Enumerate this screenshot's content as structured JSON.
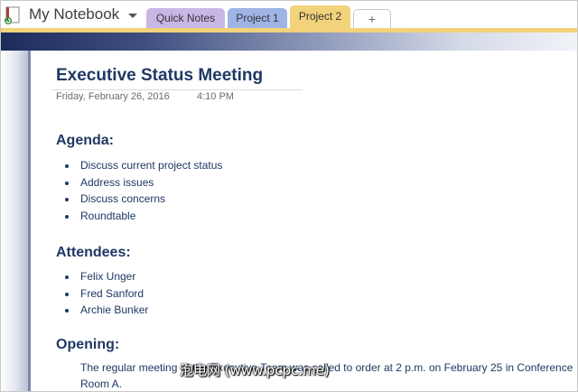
{
  "notebook": {
    "title": "My Notebook",
    "icon": "notebook-icon"
  },
  "tabs": [
    {
      "label": "Quick Notes",
      "color": "#c8b7e6"
    },
    {
      "label": "Project 1",
      "color": "#9fb4e6"
    },
    {
      "label": "Project 2",
      "color": "#f2d27a",
      "active": true
    }
  ],
  "add_tab_label": "+",
  "page": {
    "title": "Executive Status Meeting",
    "date": "Friday, February 26, 2016",
    "time": "4:10 PM",
    "agenda": {
      "heading": "Agenda:",
      "items": [
        "Discuss current project status",
        "Address issues",
        "Discuss concerns",
        "Roundtable"
      ]
    },
    "attendees": {
      "heading": "Attendees:",
      "items": [
        "Felix Unger",
        "Fred Sanford",
        "Archie Bunker"
      ]
    },
    "opening": {
      "heading": "Opening:",
      "text": "The regular meeting of the Executive Team was called to order at 2 p.m. on February 25 in Conference Room A."
    }
  },
  "watermark": "泡电网 (www.pcpc.me)"
}
